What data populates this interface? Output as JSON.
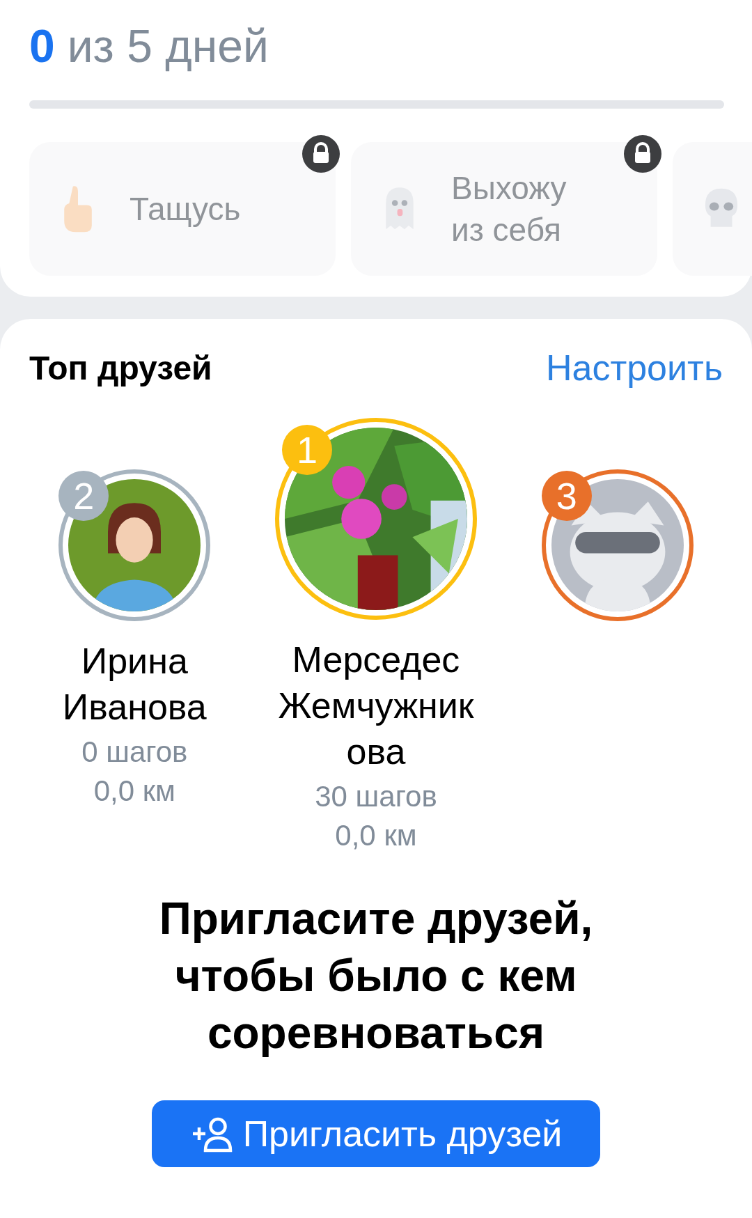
{
  "progress": {
    "count": "0",
    "total": "из 5 дней",
    "level": 0
  },
  "achievements": [
    {
      "kind": "hand",
      "label": "Тащусь",
      "locked": true
    },
    {
      "kind": "ghost",
      "label": "Выхожу\nиз себя",
      "locked": true
    },
    {
      "kind": "skull",
      "locked": false
    }
  ],
  "top_friends": {
    "title": "Топ друзей",
    "action": "Настроить",
    "friends": [
      {
        "leader": false,
        "kind": "person",
        "rank": "2",
        "color": "#a7b4bf",
        "name": "Ирина\nИванова",
        "steps": "0 шагов",
        "distance": "0,0 км"
      },
      {
        "leader": true,
        "kind": "picture",
        "rank": "1",
        "color": "#fcbf0f",
        "name": "Мерседес\nЖемчужник\nова",
        "steps": "30 шагов",
        "distance": "0,0 км"
      },
      {
        "leader": false,
        "kind": "animal",
        "rank": "3",
        "color": "#e8702a"
      }
    ]
  },
  "invite": {
    "text": "Пригласите друзей,\nчтобы было с кем соревноваться",
    "button": "Пригласить друзей"
  }
}
